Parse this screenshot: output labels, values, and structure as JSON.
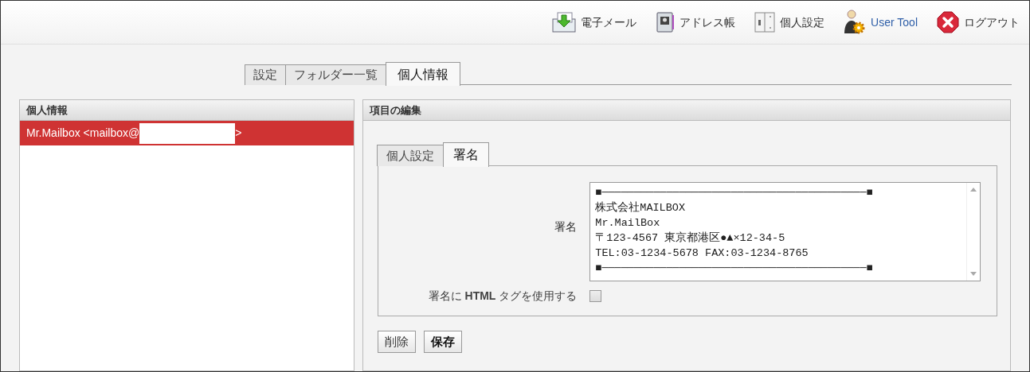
{
  "toolbar": [
    {
      "kind": "mail",
      "label": "電子メール"
    },
    {
      "kind": "addressbook",
      "label": "アドレス帳"
    },
    {
      "kind": "settings",
      "label": "個人設定"
    },
    {
      "kind": "usertool",
      "label": "User Tool"
    },
    {
      "kind": "logout",
      "label": "ログアウト"
    }
  ],
  "tabs": [
    {
      "label": "設定",
      "selected": false
    },
    {
      "label": "フォルダー一覧",
      "selected": false
    },
    {
      "label": "個人情報",
      "selected": true
    }
  ],
  "left_panel": {
    "title": "個人情報",
    "items": [
      {
        "text": "Mr.Mailbox <mailbox@",
        "suffix": ">",
        "selected": true
      }
    ]
  },
  "right_panel": {
    "title": "項目の編集",
    "tabs": [
      {
        "label": "個人設定",
        "selected": false
      },
      {
        "label": "署名",
        "selected": true
      }
    ],
    "signature": {
      "label": "署名",
      "lines": [
        "■─────────────────────────────────────────■",
        "株式会社MAILBOX",
        "Mr.MailBox",
        "〒123-4567 東京都港区●▲×12-34-5",
        "TEL:03-1234-5678 FAX:03-1234-8765",
        "■─────────────────────────────────────────■"
      ]
    },
    "html_option": {
      "label": "署名に **HTML** タグを使用する",
      "checked": false
    },
    "buttons": [
      {
        "label": "削除",
        "primary": false
      },
      {
        "label": "保存",
        "primary": true
      }
    ]
  }
}
